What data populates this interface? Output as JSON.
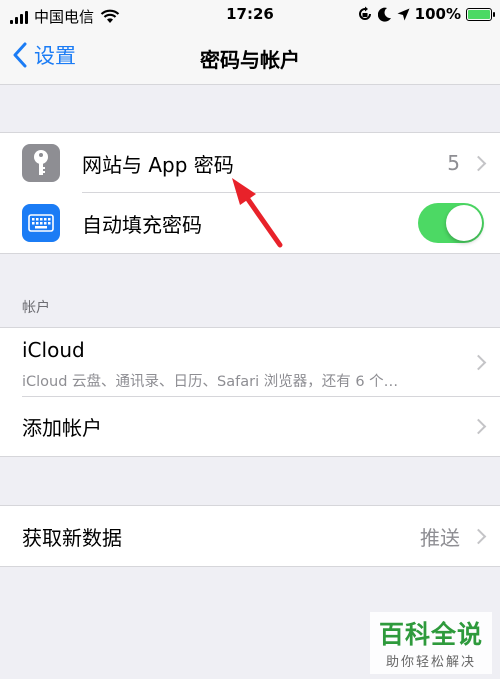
{
  "status_bar": {
    "carrier": "中国电信",
    "time": "17:26",
    "battery": "100%",
    "battery_level": 1.0,
    "icons": [
      "signal-icon",
      "wifi-icon",
      "rotation-lock-icon",
      "moon-icon",
      "location-icon",
      "battery-icon"
    ]
  },
  "nav": {
    "back_label": "设置",
    "title": "密码与帐户"
  },
  "passwords": {
    "website_passwords_label": "网站与 App 密码",
    "website_passwords_count": "5",
    "autofill_label": "自动填充密码",
    "autofill_enabled": true
  },
  "accounts": {
    "header": "帐户",
    "icloud_label": "iCloud",
    "icloud_subtitle": "iCloud 云盘、通讯录、日历、Safari 浏览器，还有 6 个…",
    "add_account_label": "添加帐户"
  },
  "fetch": {
    "label": "获取新数据",
    "value": "推送"
  },
  "watermark": {
    "main": "百科全说",
    "sub": "助你轻松解决"
  },
  "colors": {
    "accent": "#1b7cf5",
    "toggle_on": "#4cd964",
    "key_icon_bg": "#8e8e93",
    "keyboard_icon_bg": "#1b7cf5",
    "arrow": "#e8222a"
  }
}
